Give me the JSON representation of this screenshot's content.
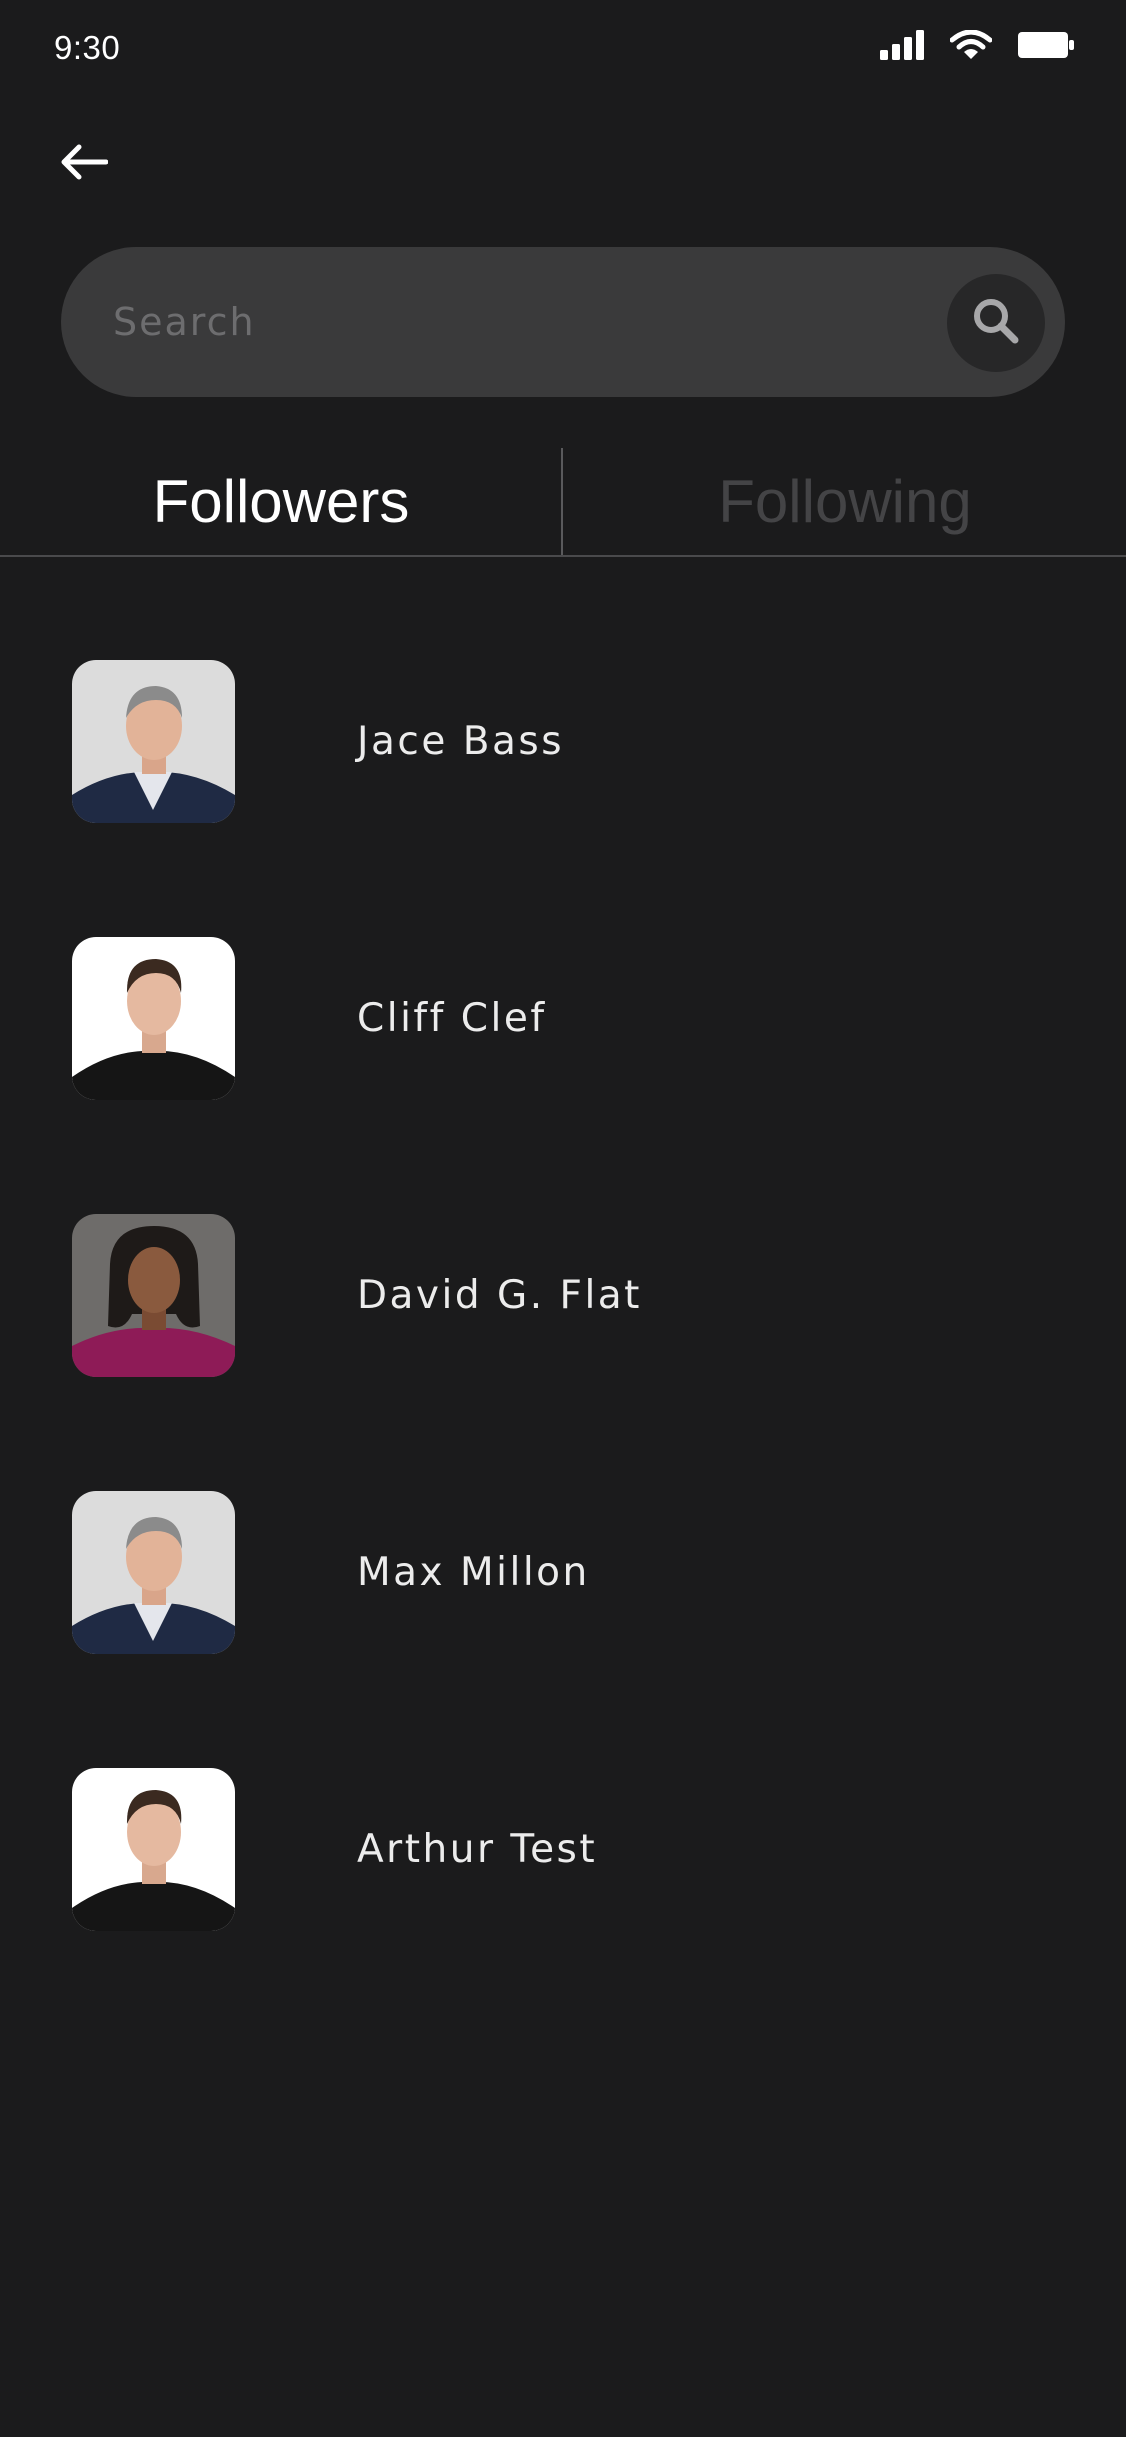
{
  "status_bar": {
    "time": "9:30",
    "icons": [
      "cellular-signal-icon",
      "wifi-icon",
      "battery-icon"
    ]
  },
  "header": {
    "back_icon": "arrow-left-icon"
  },
  "search": {
    "placeholder": "Search",
    "value": "",
    "icon": "search-icon"
  },
  "tabs": {
    "followers_label": "Followers",
    "following_label": "Following",
    "active": "Followers"
  },
  "followers": [
    {
      "name": "Jace Bass",
      "avatar": "man-grey-hair-suit"
    },
    {
      "name": "Cliff Clef",
      "avatar": "man-dark-hair-black-shirt"
    },
    {
      "name": "David G. Flat",
      "avatar": "woman-magenta-top"
    },
    {
      "name": "Max Millon",
      "avatar": "man-grey-hair-suit"
    },
    {
      "name": "Arthur Test",
      "avatar": "man-dark-hair-black-shirt"
    }
  ],
  "colors": {
    "background": "#1b1b1c",
    "search_bar": "#3a3a3b",
    "search_button": "#272728",
    "active_tab": "#ffffff",
    "inactive_tab": "#444446",
    "name_text": "#ececec"
  }
}
